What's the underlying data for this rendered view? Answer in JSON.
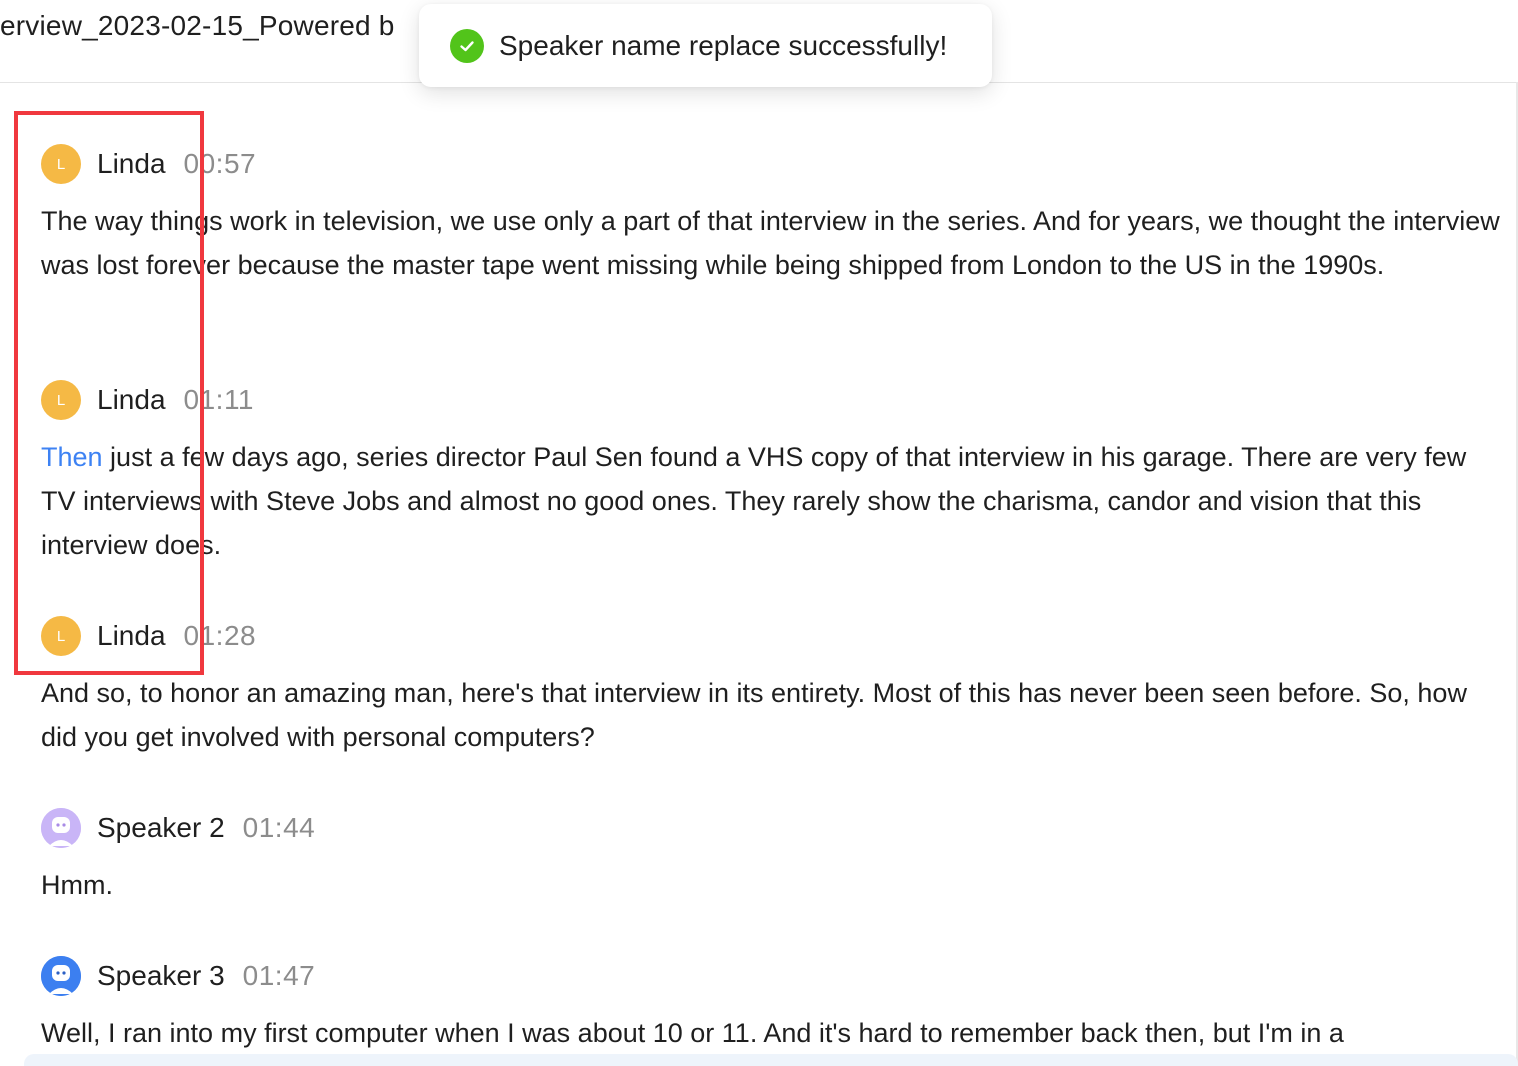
{
  "header": {
    "title": "erview_2023-02-15_Powered b"
  },
  "toast": {
    "icon": "check-circle-icon",
    "message": "Speaker name replace successfully!"
  },
  "segments": [
    {
      "speaker": "Linda",
      "avatar_letter": "L",
      "time": "00:57",
      "text": "The way things work in television, we use only a part of that interview in the series. And for years, we thought the interview was lost forever because the master tape went missing while being shipped from London to the US in the 1990s."
    },
    {
      "speaker": "Linda",
      "avatar_letter": "L",
      "time": "01:11",
      "highlight_word": "Then",
      "text": " just a few days ago, series director Paul Sen found a VHS copy of that interview in his garage. There are very few TV interviews with Steve Jobs and almost no good ones. They rarely show the charisma, candor and vision that this interview does."
    },
    {
      "speaker": "Linda",
      "avatar_letter": "L",
      "time": "01:28",
      "text": "And so, to honor an amazing man, here's that interview in its entirety. Most of this has never been seen before. So, how did you get involved with personal computers?"
    },
    {
      "speaker": "Speaker 2",
      "avatar_icon": "robot-avatar-icon",
      "time": "01:44",
      "text": "Hmm."
    },
    {
      "speaker": "Speaker 3",
      "avatar_icon": "robot-avatar-icon",
      "time": "01:47",
      "text": "Well, I ran into my first computer when I was about 10 or 11. And it's hard to remember back then, but I'm in a"
    }
  ],
  "colors": {
    "linda_avatar": "#f5b945",
    "speaker2_avatar": "#c9b5f7",
    "speaker3_avatar": "#3c7ff0",
    "highlight": "#3d82f3",
    "success": "#52c41a",
    "annotation_box": "#f0383e"
  }
}
